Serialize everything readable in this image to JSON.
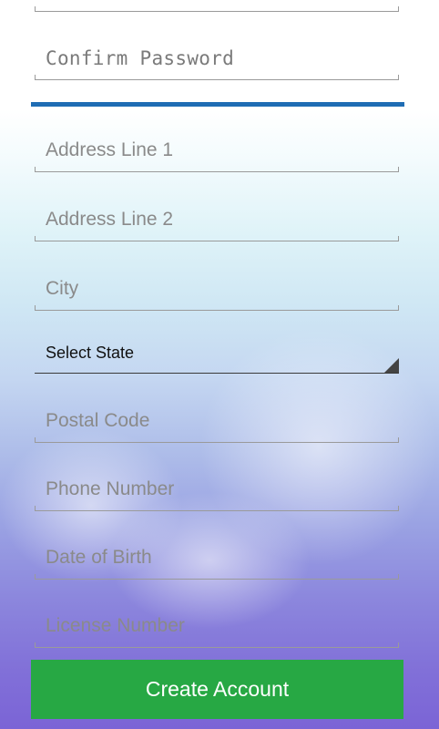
{
  "form": {
    "confirm_password_placeholder": "Confirm Password",
    "address_line_1_placeholder": "Address Line 1",
    "address_line_2_placeholder": "Address Line 2",
    "city_placeholder": "City",
    "state_select_value": "Select State",
    "postal_code_placeholder": "Postal Code",
    "phone_number_placeholder": "Phone Number",
    "date_of_birth_placeholder": "Date of Birth",
    "license_number_placeholder": "License Number",
    "create_account_label": "Create Account"
  },
  "colors": {
    "divider": "#1f6db4",
    "button": "#27a844",
    "button_text": "#ffffff"
  }
}
